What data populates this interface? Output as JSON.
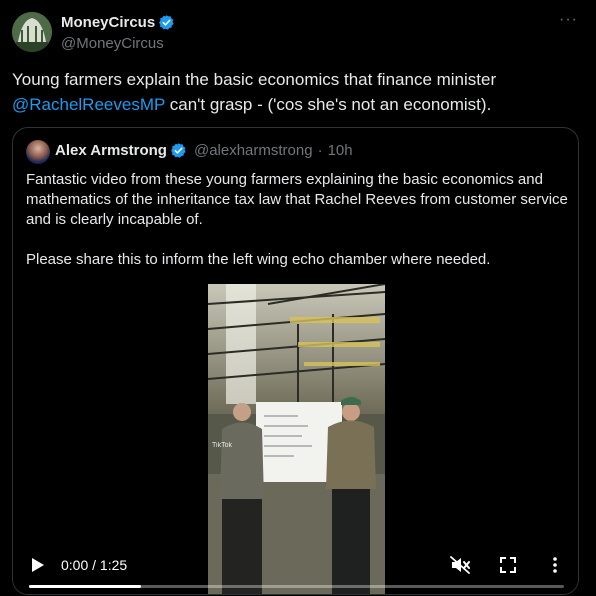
{
  "author": {
    "display_name": "MoneyCircus",
    "handle": "@MoneyCircus",
    "verified": true
  },
  "tweet": {
    "text_before_mention": "Young farmers explain the basic economics that  finance minister ",
    "mention": "@RachelReevesMP",
    "text_after_mention": " can't grasp - ('cos she's not an economist)."
  },
  "more_icon": "ellipsis-icon",
  "quote": {
    "display_name": "Alex Armstrong",
    "handle": "@alexharmstrong",
    "separator": "·",
    "time": "10h",
    "verified": true,
    "paragraph_1": "Fantastic video from these young farmers explaining the basic economics and mathematics of the inheritance tax law that Rachel Reeves from customer service and is clearly incapable of.",
    "paragraph_2": "Please share this to inform the left wing echo chamber where needed."
  },
  "video": {
    "watermark_brand": "TikTok",
    "time_display": "0:00 / 1:25",
    "progress": 0.21,
    "muted": true,
    "icons": [
      "play-icon",
      "mute-icon",
      "fullscreen-icon",
      "more-vertical-icon"
    ]
  },
  "colors": {
    "background": "#000000",
    "text": "#e7e9ea",
    "secondary": "#71767b",
    "accent": "#1d9bf0",
    "border": "#2f3336"
  }
}
